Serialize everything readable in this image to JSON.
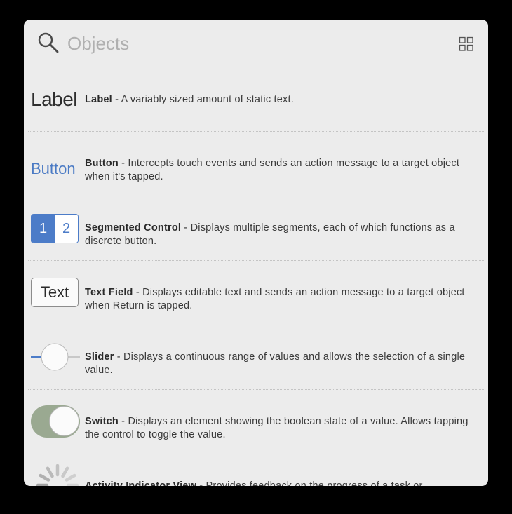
{
  "search": {
    "placeholder": "Objects",
    "icon": "search-icon",
    "grid_icon": "grid-view-icon"
  },
  "colors": {
    "accent": "#4c7cc8",
    "panel_bg": "#ececec",
    "switch_on": "#9aa991"
  },
  "items": [
    {
      "name": "Label",
      "sep": " - ",
      "description": "A variably sized amount of static text.",
      "thumb_text": "Label"
    },
    {
      "name": "Button",
      "sep": " - ",
      "description": "Intercepts touch events and sends an action message to a target object when it's tapped.",
      "thumb_text": "Button"
    },
    {
      "name": "Segmented Control",
      "sep": " - ",
      "description": "Displays multiple segments, each of which functions as a discrete button.",
      "thumb_segments": [
        "1",
        "2"
      ]
    },
    {
      "name": "Text Field",
      "sep": " - ",
      "description": "Displays editable text and sends an action message to a target object when Return is tapped.",
      "thumb_text": "Text"
    },
    {
      "name": "Slider",
      "sep": " - ",
      "description": "Displays a continuous range of values and allows the selection of a single value."
    },
    {
      "name": "Switch",
      "sep": " - ",
      "description": "Displays an element showing the boolean state of a value. Allows tapping the control to toggle the value."
    },
    {
      "name": "Activity Indicator View",
      "sep": " - ",
      "description": "Provides feedback on the progress of a task or"
    }
  ]
}
